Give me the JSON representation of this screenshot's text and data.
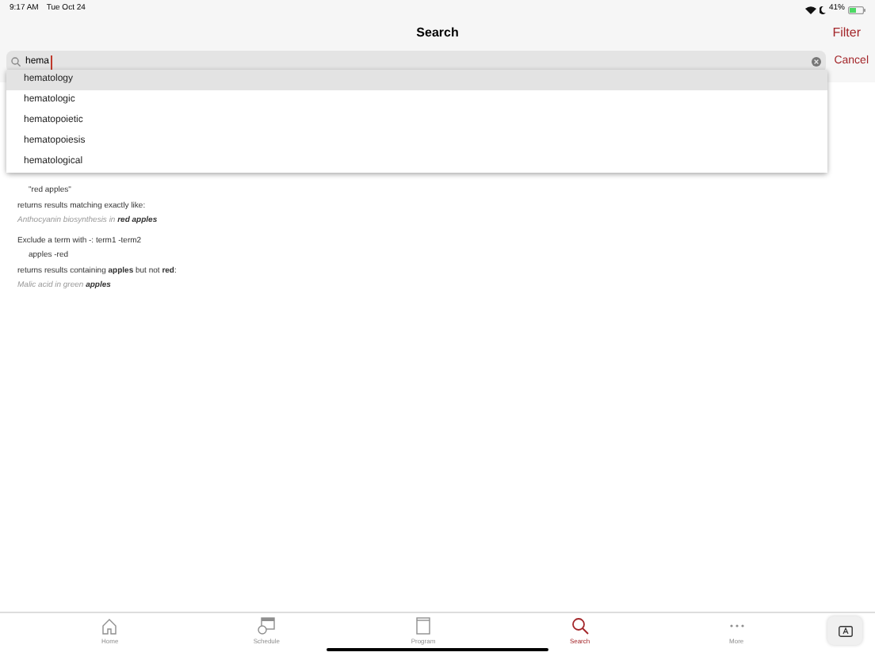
{
  "status_bar": {
    "time": "9:17 AM",
    "date": "Tue Oct 24",
    "battery": "41%"
  },
  "nav": {
    "title": "Search",
    "filter": "Filter"
  },
  "search": {
    "value": "hema",
    "cancel": "Cancel"
  },
  "suggestions": [
    {
      "text": "hematology",
      "selected": true
    },
    {
      "text": "hematologic",
      "selected": false
    },
    {
      "text": "hematopoietic",
      "selected": false
    },
    {
      "text": "hematopoiesis",
      "selected": false
    },
    {
      "text": "hematological",
      "selected": false
    }
  ],
  "help": [
    {
      "kind": "example",
      "text": "\"red apples\""
    },
    {
      "kind": "text",
      "text": "returns results matching exactly like:"
    },
    {
      "kind": "sample",
      "text": "Anthocyanin biosynthesis in **red apples**"
    },
    {
      "kind": "heading",
      "text": "Exclude a term with -: term1 -term2"
    },
    {
      "kind": "example",
      "text": "apples -red"
    },
    {
      "kind": "text",
      "text": "returns results containing **apples** but not **red**:"
    },
    {
      "kind": "sample",
      "text": "Malic acid in green **apples**"
    }
  ],
  "tabs": [
    {
      "kind": "home",
      "label": "Home",
      "selected": false
    },
    {
      "kind": "schedule",
      "label": "Schedule",
      "selected": false
    },
    {
      "kind": "program",
      "label": "Program",
      "selected": false
    },
    {
      "kind": "search",
      "label": "Search",
      "selected": true
    },
    {
      "kind": "more",
      "label": "More",
      "selected": false
    }
  ]
}
